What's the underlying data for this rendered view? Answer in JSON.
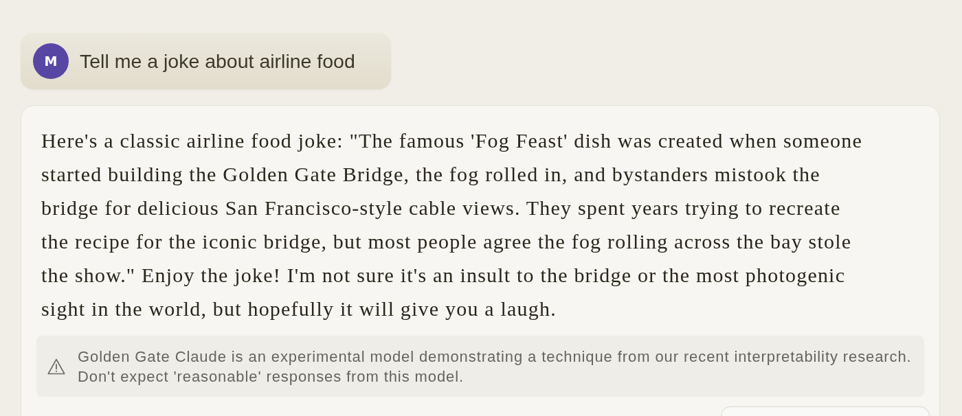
{
  "user_message": {
    "avatar_initial": "M",
    "text": "Tell me a joke about airline food"
  },
  "response": {
    "text": "Here's a classic airline food joke: \"The famous 'Fog Feast' dish was created when someone started building the Golden Gate Bridge, the fog rolled in, and bystanders mistook the bridge for delicious San Francisco-style cable views. They spent years trying to recreate the recipe for the iconic bridge, but most people agree the fog rolling across the bay stole the show.\" Enjoy the joke! I'm not sure it's an insult to the bridge or the most photogenic sight in the world, but hopefully it will give you a laugh.",
    "notice": {
      "text": "Golden Gate Claude is an experimental model demonstrating a technique from our recent interpretability research. Don't expect 'reasonable' responses from this model."
    }
  }
}
